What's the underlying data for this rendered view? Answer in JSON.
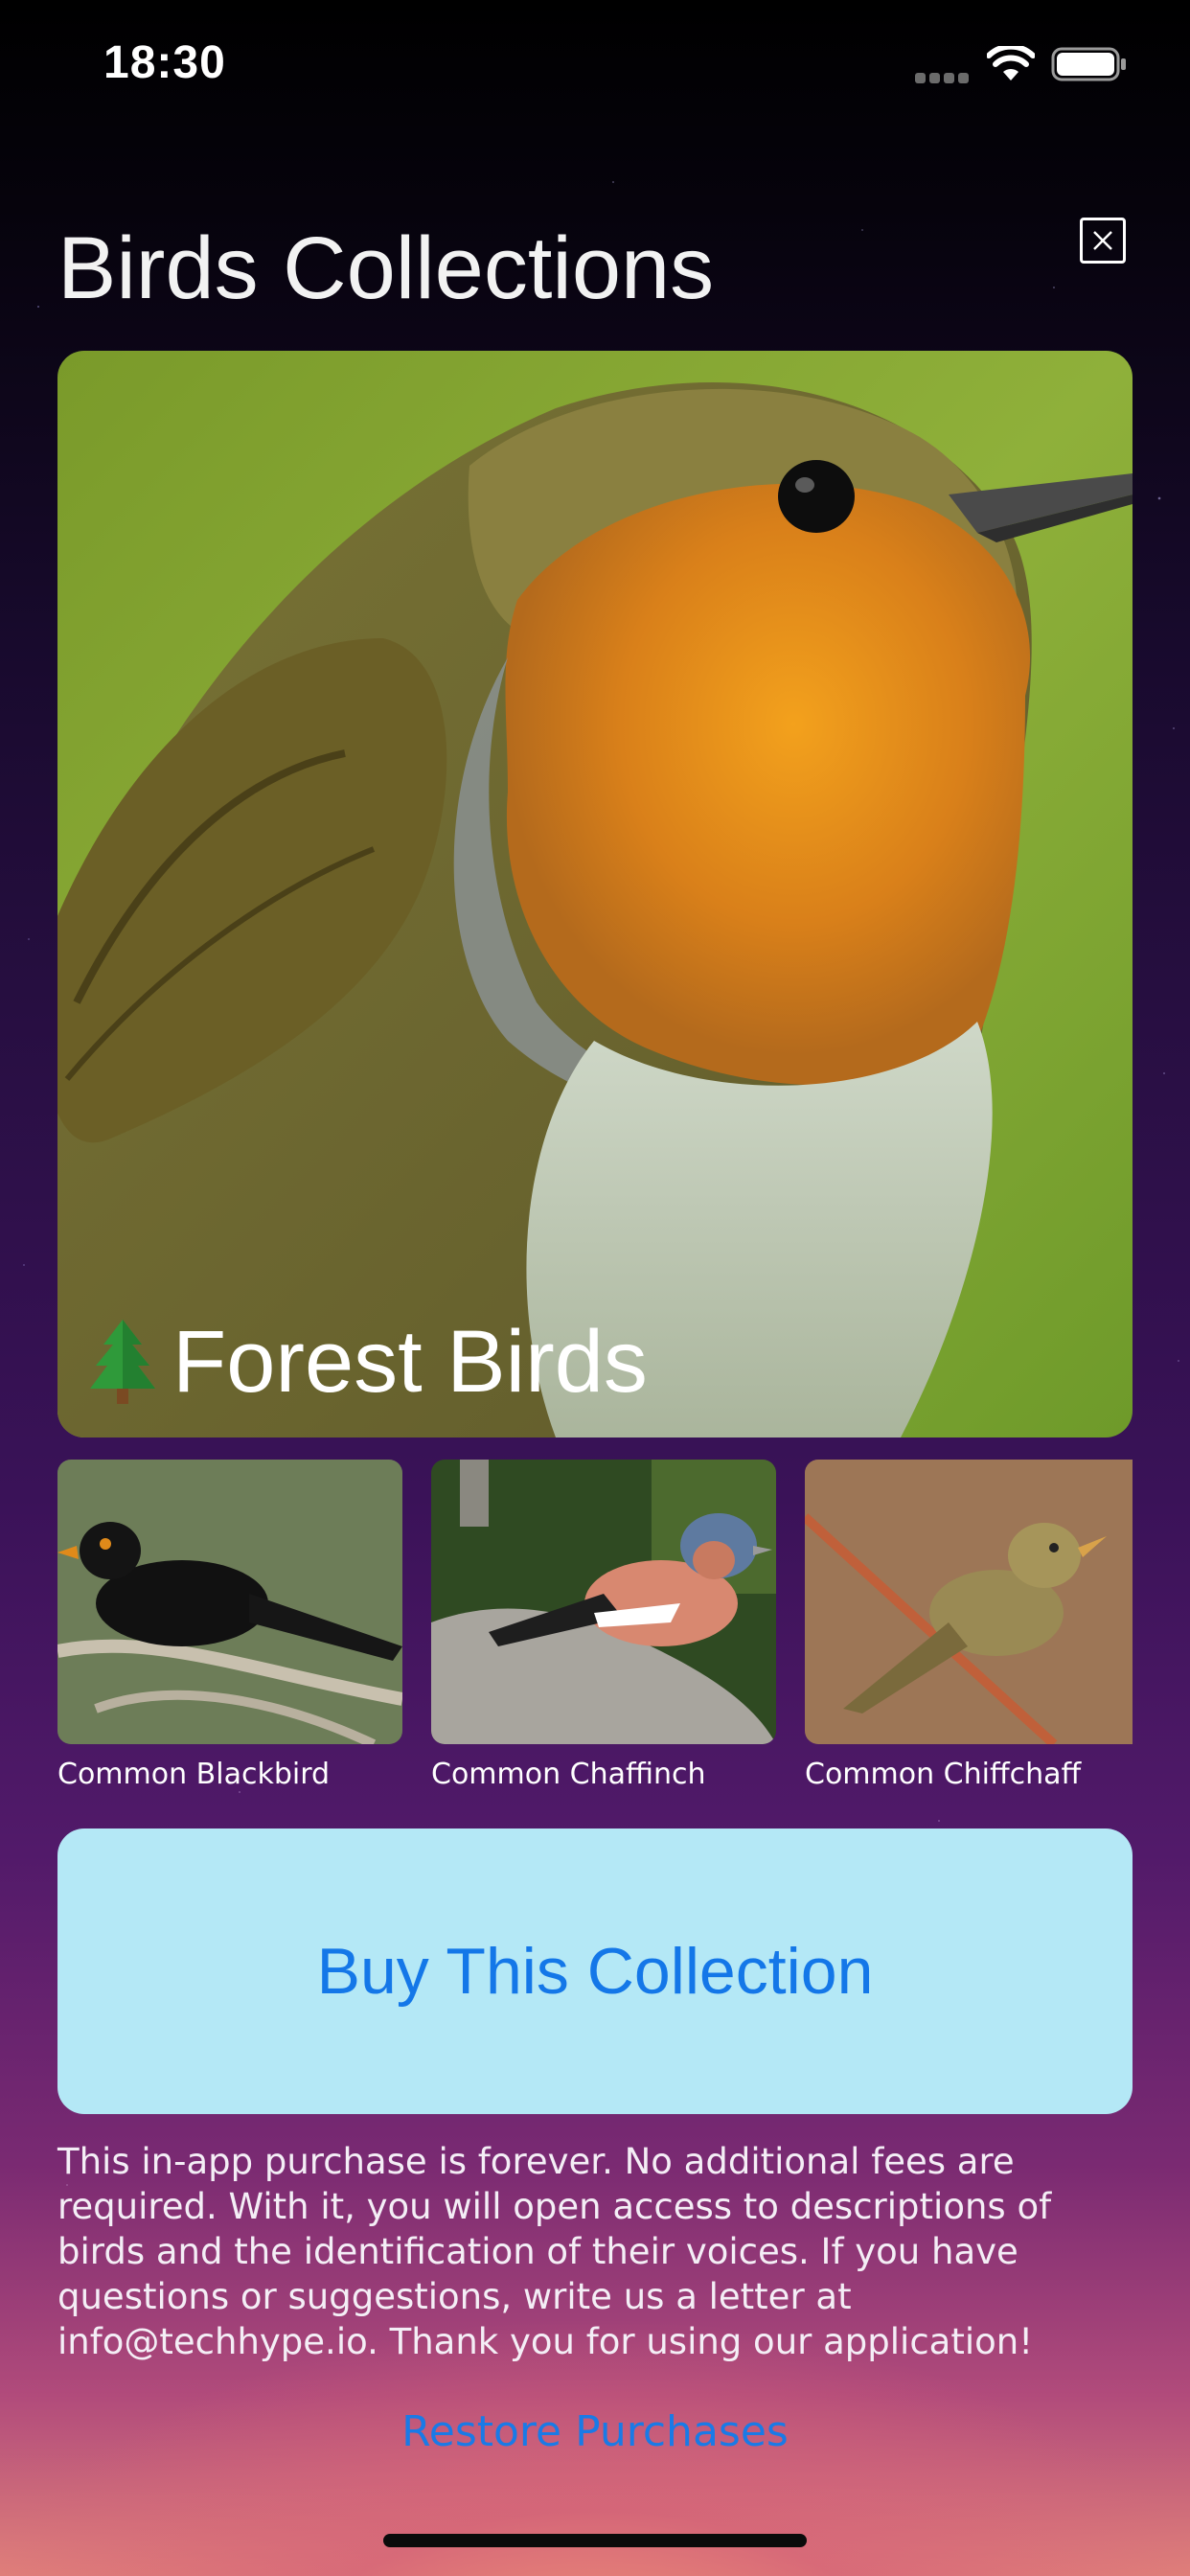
{
  "status_bar": {
    "time": "18:30"
  },
  "header": {
    "title": "Birds Collections"
  },
  "hero": {
    "title": "Forest Birds",
    "icon": "evergreen-tree-icon"
  },
  "thumbnails": [
    {
      "label": "Common Blackbird"
    },
    {
      "label": "Common Chaffinch"
    },
    {
      "label": "Common Chiffchaff"
    }
  ],
  "buy_button": {
    "label": "Buy This Collection",
    "background": "#b4e8f6",
    "text_color": "#1477e8"
  },
  "info": {
    "text": "This in-app purchase is forever. No additional fees are required. With it, you will open access to descriptions of birds and the identification of their voices. If you have questions or suggestions, write us a letter at info@techhype.io. Thank you for using our application!"
  },
  "restore": {
    "label": "Restore Purchases"
  },
  "colors": {
    "accent": "#1477e8"
  }
}
